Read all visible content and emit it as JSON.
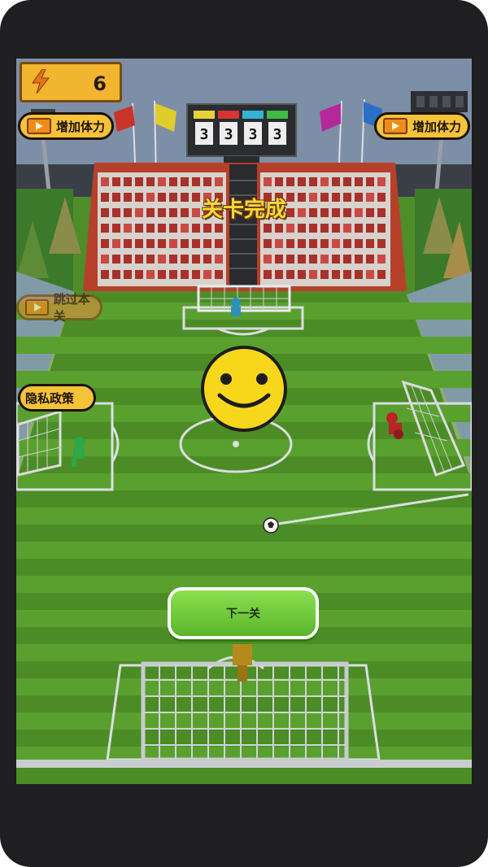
{
  "hud": {
    "energy_value": "6",
    "energy_timer": "",
    "energy_cap": ""
  },
  "buttons": {
    "add_stamina_left": "增加体力",
    "add_stamina_right": "增加体力",
    "skip_level": "跳过本关",
    "privacy_policy": "隐私政策",
    "next": "下一关"
  },
  "status": {
    "level_complete": "关卡完成"
  },
  "scoreboard": {
    "scores": [
      "3",
      "3",
      "3",
      "3"
    ],
    "team_colors": [
      "#e8d237",
      "#d83434",
      "#33b4d6",
      "#3dbb44"
    ]
  },
  "colors": {
    "pill_yellow": "#f5c23a",
    "next_green": "#6fcb38",
    "title_yellow": "#f7d83a",
    "pitch_light": "#5aa02f",
    "pitch_dark": "#4c8c26"
  },
  "icons": {
    "energy": "lightning-bolt-icon",
    "video": "video-play-icon",
    "emoji": "smiley-face-icon"
  }
}
